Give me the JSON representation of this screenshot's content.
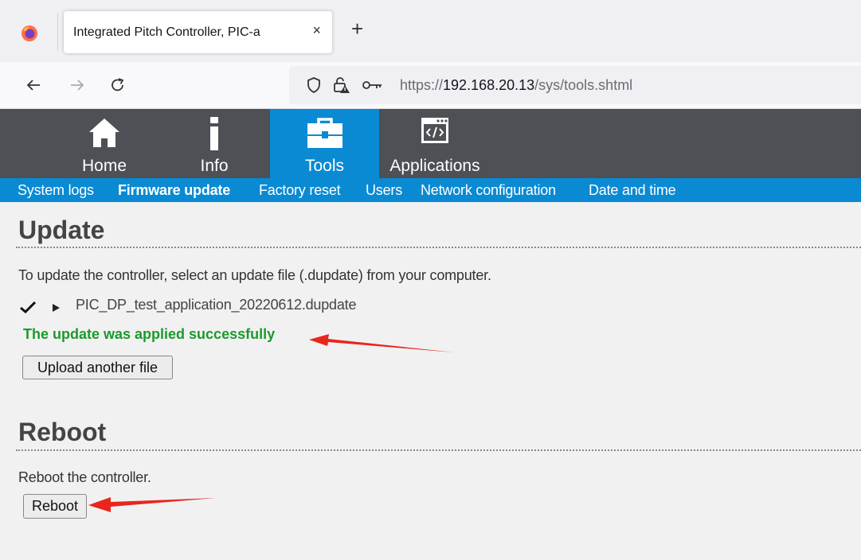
{
  "browser": {
    "tab_title": "Integrated Pitch Controller, PIC-a",
    "tab_close": "×",
    "new_tab": "+",
    "url_scheme": "https://",
    "url_host": "192.168.20.13",
    "url_path": "/sys/tools.shtml"
  },
  "menu": {
    "items": [
      {
        "label": "Home",
        "icon": "home-icon"
      },
      {
        "label": "Info",
        "icon": "info-icon"
      },
      {
        "label": "Tools",
        "icon": "toolbox-icon",
        "active": true
      },
      {
        "label": "Applications",
        "icon": "code-window-icon"
      }
    ]
  },
  "submenu": {
    "items": [
      {
        "label": "System logs"
      },
      {
        "label": "Firmware update",
        "active": true
      },
      {
        "label": "Factory reset"
      },
      {
        "label": "Users"
      },
      {
        "label": "Network configuration"
      },
      {
        "label": "Date and time"
      }
    ]
  },
  "update": {
    "title": "Update",
    "description": "To update the controller, select an update file (.dupdate) from your computer.",
    "file_name": "PIC_DP_test_application_20220612.dupdate",
    "status": "The update was applied successfully",
    "upload_button": "Upload another file"
  },
  "reboot": {
    "title": "Reboot",
    "description": "Reboot the controller.",
    "button": "Reboot"
  },
  "colors": {
    "header": "#4d5055",
    "accent": "#0a8ad3",
    "success": "#1b9a2c",
    "annotation_arrow": "#e8261e"
  }
}
